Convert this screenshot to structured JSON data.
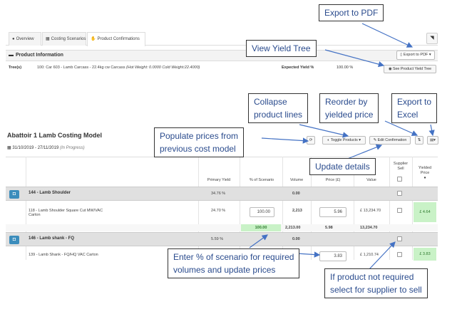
{
  "tabs": [
    {
      "label": "Overview",
      "icon": "info-icon"
    },
    {
      "label": "Costing Scenarios",
      "icon": "calculator-icon"
    },
    {
      "label": "Product Confirmations",
      "icon": "thumbs-up-icon"
    }
  ],
  "product_info": {
    "title": "Product Information",
    "export_pdf_label": "Export to PDF ▾",
    "tree_label": "Tree(s)",
    "tree_text": "100: Car 603 - Lamb Carcass - 22.4kg cw Carcass",
    "tree_detail": "(Hot Weight: 0.0000 Cold Weight:22.4000)",
    "expected_yield_label": "Expected Yield %",
    "expected_yield_value": "100.00 %",
    "yield_tree_label": "See Product Yield Tree"
  },
  "model": {
    "title": "Abattoir 1 Lamb Costing Model",
    "dates": "31/10/2019 - 27/11/2019",
    "status": "(In Progress)",
    "toggle_label": "Toggle Products ▾",
    "edit_label": "Edit Confirmation",
    "columns": {
      "primary_yield": "Primary Yield",
      "pct_scenario": "% of Scenario",
      "volume": "Volume",
      "price": "Price (£)",
      "value": "Value",
      "supplier_sell": "Supplier Sell",
      "yielded_price": "Yielded Price"
    },
    "groups": [
      {
        "name": "144 - Lamb Shoulder",
        "primary_yield": "34.76 %",
        "volume": "0.00",
        "product": {
          "name_line1": "118 - Lamb Shoulder Square Cut MW/VAC",
          "name_line2": "Carton",
          "primary_yield": "24.70 %",
          "pct": "100.00",
          "volume": "2,213",
          "price": "5.96",
          "value": "£ 13,234.70",
          "yielded_price": "£ 4.64"
        },
        "subtotal": {
          "pct": "100.00",
          "volume": "2,213.00",
          "price": "5.98",
          "value": "13,234.70"
        }
      },
      {
        "name": "146 - Lamb shank - FQ",
        "primary_yield": "5.59 %",
        "volume": "0.00",
        "product": {
          "name_line1": "139 - Lamb Shank - FQ/HQ VAC Carton",
          "price": "3.83",
          "value": "£ 1,210.74",
          "yielded_price": "£ 3.83"
        }
      }
    ]
  },
  "callouts": {
    "export_pdf": "Export to PDF",
    "view_yield_tree": "View Yield Tree",
    "collapse_line1": "Collapse",
    "collapse_line2": "product lines",
    "reorder_line1": "Reorder by",
    "reorder_line2": "yielded price",
    "excel_line1": "Export to",
    "excel_line2": "Excel",
    "populate_line1": "Populate prices from",
    "populate_line2": "previous cost model",
    "update_details": "Update details",
    "enter_line1": "Enter % of scenario for required",
    "enter_line2": "volumes and update prices",
    "notreq_line1": "If product not required",
    "notreq_line2": "select for supplier to sell"
  },
  "colors": {
    "accent": "#3c8dbc",
    "callout_text": "#2a4b8d",
    "arrow": "#4472c4",
    "highlight": "#c9f2c7"
  }
}
